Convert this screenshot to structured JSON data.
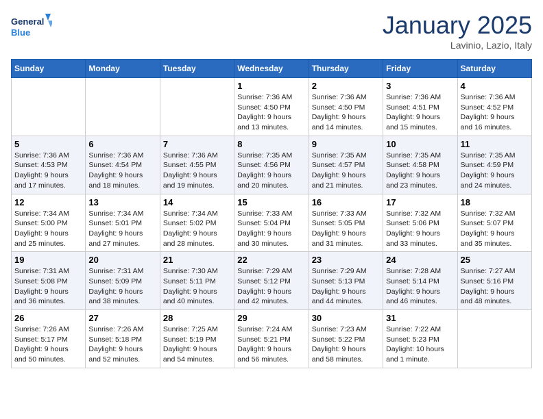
{
  "header": {
    "logo_line1": "General",
    "logo_line2": "Blue",
    "month": "January 2025",
    "location": "Lavinio, Lazio, Italy"
  },
  "weekdays": [
    "Sunday",
    "Monday",
    "Tuesday",
    "Wednesday",
    "Thursday",
    "Friday",
    "Saturday"
  ],
  "weeks": [
    [
      {
        "day": "",
        "info": ""
      },
      {
        "day": "",
        "info": ""
      },
      {
        "day": "",
        "info": ""
      },
      {
        "day": "1",
        "info": "Sunrise: 7:36 AM\nSunset: 4:50 PM\nDaylight: 9 hours\nand 13 minutes."
      },
      {
        "day": "2",
        "info": "Sunrise: 7:36 AM\nSunset: 4:50 PM\nDaylight: 9 hours\nand 14 minutes."
      },
      {
        "day": "3",
        "info": "Sunrise: 7:36 AM\nSunset: 4:51 PM\nDaylight: 9 hours\nand 15 minutes."
      },
      {
        "day": "4",
        "info": "Sunrise: 7:36 AM\nSunset: 4:52 PM\nDaylight: 9 hours\nand 16 minutes."
      }
    ],
    [
      {
        "day": "5",
        "info": "Sunrise: 7:36 AM\nSunset: 4:53 PM\nDaylight: 9 hours\nand 17 minutes."
      },
      {
        "day": "6",
        "info": "Sunrise: 7:36 AM\nSunset: 4:54 PM\nDaylight: 9 hours\nand 18 minutes."
      },
      {
        "day": "7",
        "info": "Sunrise: 7:36 AM\nSunset: 4:55 PM\nDaylight: 9 hours\nand 19 minutes."
      },
      {
        "day": "8",
        "info": "Sunrise: 7:35 AM\nSunset: 4:56 PM\nDaylight: 9 hours\nand 20 minutes."
      },
      {
        "day": "9",
        "info": "Sunrise: 7:35 AM\nSunset: 4:57 PM\nDaylight: 9 hours\nand 21 minutes."
      },
      {
        "day": "10",
        "info": "Sunrise: 7:35 AM\nSunset: 4:58 PM\nDaylight: 9 hours\nand 23 minutes."
      },
      {
        "day": "11",
        "info": "Sunrise: 7:35 AM\nSunset: 4:59 PM\nDaylight: 9 hours\nand 24 minutes."
      }
    ],
    [
      {
        "day": "12",
        "info": "Sunrise: 7:34 AM\nSunset: 5:00 PM\nDaylight: 9 hours\nand 25 minutes."
      },
      {
        "day": "13",
        "info": "Sunrise: 7:34 AM\nSunset: 5:01 PM\nDaylight: 9 hours\nand 27 minutes."
      },
      {
        "day": "14",
        "info": "Sunrise: 7:34 AM\nSunset: 5:02 PM\nDaylight: 9 hours\nand 28 minutes."
      },
      {
        "day": "15",
        "info": "Sunrise: 7:33 AM\nSunset: 5:04 PM\nDaylight: 9 hours\nand 30 minutes."
      },
      {
        "day": "16",
        "info": "Sunrise: 7:33 AM\nSunset: 5:05 PM\nDaylight: 9 hours\nand 31 minutes."
      },
      {
        "day": "17",
        "info": "Sunrise: 7:32 AM\nSunset: 5:06 PM\nDaylight: 9 hours\nand 33 minutes."
      },
      {
        "day": "18",
        "info": "Sunrise: 7:32 AM\nSunset: 5:07 PM\nDaylight: 9 hours\nand 35 minutes."
      }
    ],
    [
      {
        "day": "19",
        "info": "Sunrise: 7:31 AM\nSunset: 5:08 PM\nDaylight: 9 hours\nand 36 minutes."
      },
      {
        "day": "20",
        "info": "Sunrise: 7:31 AM\nSunset: 5:09 PM\nDaylight: 9 hours\nand 38 minutes."
      },
      {
        "day": "21",
        "info": "Sunrise: 7:30 AM\nSunset: 5:11 PM\nDaylight: 9 hours\nand 40 minutes."
      },
      {
        "day": "22",
        "info": "Sunrise: 7:29 AM\nSunset: 5:12 PM\nDaylight: 9 hours\nand 42 minutes."
      },
      {
        "day": "23",
        "info": "Sunrise: 7:29 AM\nSunset: 5:13 PM\nDaylight: 9 hours\nand 44 minutes."
      },
      {
        "day": "24",
        "info": "Sunrise: 7:28 AM\nSunset: 5:14 PM\nDaylight: 9 hours\nand 46 minutes."
      },
      {
        "day": "25",
        "info": "Sunrise: 7:27 AM\nSunset: 5:16 PM\nDaylight: 9 hours\nand 48 minutes."
      }
    ],
    [
      {
        "day": "26",
        "info": "Sunrise: 7:26 AM\nSunset: 5:17 PM\nDaylight: 9 hours\nand 50 minutes."
      },
      {
        "day": "27",
        "info": "Sunrise: 7:26 AM\nSunset: 5:18 PM\nDaylight: 9 hours\nand 52 minutes."
      },
      {
        "day": "28",
        "info": "Sunrise: 7:25 AM\nSunset: 5:19 PM\nDaylight: 9 hours\nand 54 minutes."
      },
      {
        "day": "29",
        "info": "Sunrise: 7:24 AM\nSunset: 5:21 PM\nDaylight: 9 hours\nand 56 minutes."
      },
      {
        "day": "30",
        "info": "Sunrise: 7:23 AM\nSunset: 5:22 PM\nDaylight: 9 hours\nand 58 minutes."
      },
      {
        "day": "31",
        "info": "Sunrise: 7:22 AM\nSunset: 5:23 PM\nDaylight: 10 hours\nand 1 minute."
      },
      {
        "day": "",
        "info": ""
      }
    ]
  ]
}
